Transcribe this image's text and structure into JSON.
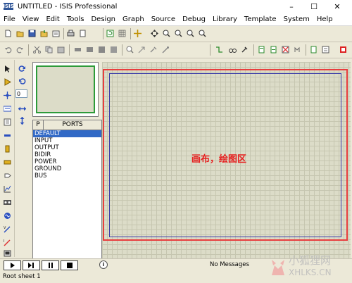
{
  "window": {
    "app_icon_text": "ISIS",
    "title": "UNTITLED - ISIS Professional",
    "controls": {
      "minimize": "–",
      "maximize": "☐",
      "close": "✕"
    }
  },
  "menu": [
    "File",
    "View",
    "Edit",
    "Tools",
    "Design",
    "Graph",
    "Source",
    "Debug",
    "Library",
    "Template",
    "System",
    "Help"
  ],
  "toolbar_icons": {
    "row1": [
      "new-file-icon",
      "open-folder-icon",
      "save-icon",
      "import-icon",
      "export-icon",
      "print-icon",
      "print-area-icon",
      "refresh-icon",
      "grid-toggle-icon",
      "origin-icon",
      "pan-icon",
      "zoom-in-icon",
      "zoom-out-icon",
      "zoom-all-icon",
      "zoom-area-icon"
    ],
    "row2": [
      "undo-icon",
      "redo-icon",
      "cut-icon",
      "copy-icon",
      "paste-icon",
      "block-copy-icon",
      "block-move-icon",
      "block-rotate-icon",
      "block-delete-icon",
      "pick-device-icon",
      "make-device-icon",
      "package-tool-icon",
      "decompose-icon",
      "wire-autorouter-icon",
      "search-tag-icon",
      "property-tool-icon",
      "new-sheet-icon",
      "remove-sheet-icon",
      "goto-sheet-icon",
      "bom-icon",
      "netlist-icon",
      "ares-icon"
    ]
  },
  "left_toolbar_icons": [
    "select-arrow-icon",
    "component-icon",
    "junction-dot-icon",
    "wire-label-icon",
    "text-script-icon",
    "bus-icon",
    "subcircuit-icon",
    "terminals-icon",
    "device-pin-icon",
    "graph-icon",
    "tape-recorder-icon",
    "generator-icon",
    "voltage-probe-icon",
    "current-probe-icon",
    "virtual-instrument-icon"
  ],
  "rotation": {
    "clockwise_icon": "rotate-cw-icon",
    "anticlockwise_icon": "rotate-ccw-icon",
    "angle_value": "0",
    "mirror_x_icon": "mirror-horizontal-icon",
    "mirror_y_icon": "mirror-vertical-icon"
  },
  "selector": {
    "tab_label": "P",
    "header": "PORTS",
    "items": [
      {
        "label": "DEFAULT",
        "selected": true
      },
      {
        "label": "INPUT",
        "selected": false
      },
      {
        "label": "OUTPUT",
        "selected": false
      },
      {
        "label": "BIDIR",
        "selected": false
      },
      {
        "label": "POWER",
        "selected": false
      },
      {
        "label": "GROUND",
        "selected": false
      },
      {
        "label": "BUS",
        "selected": false
      }
    ]
  },
  "canvas": {
    "label": "画布，绘图区"
  },
  "status": {
    "messages": "No Messages",
    "sheet": "Root sheet 1",
    "sim_buttons": [
      "play-icon",
      "step-icon",
      "pause-icon",
      "stop-icon"
    ]
  },
  "watermark": {
    "text_cn": "小狐狸网",
    "text_en": "XHLKS.CN"
  },
  "colors": {
    "sheet_border": "#e83e3e",
    "sheet_inner_border": "#3a3aa8",
    "overview_frame": "#2e9b3a",
    "selected_item": "#3169c6",
    "canvas_bg": "#dcdcc8",
    "annotation_text": "#e62020"
  }
}
